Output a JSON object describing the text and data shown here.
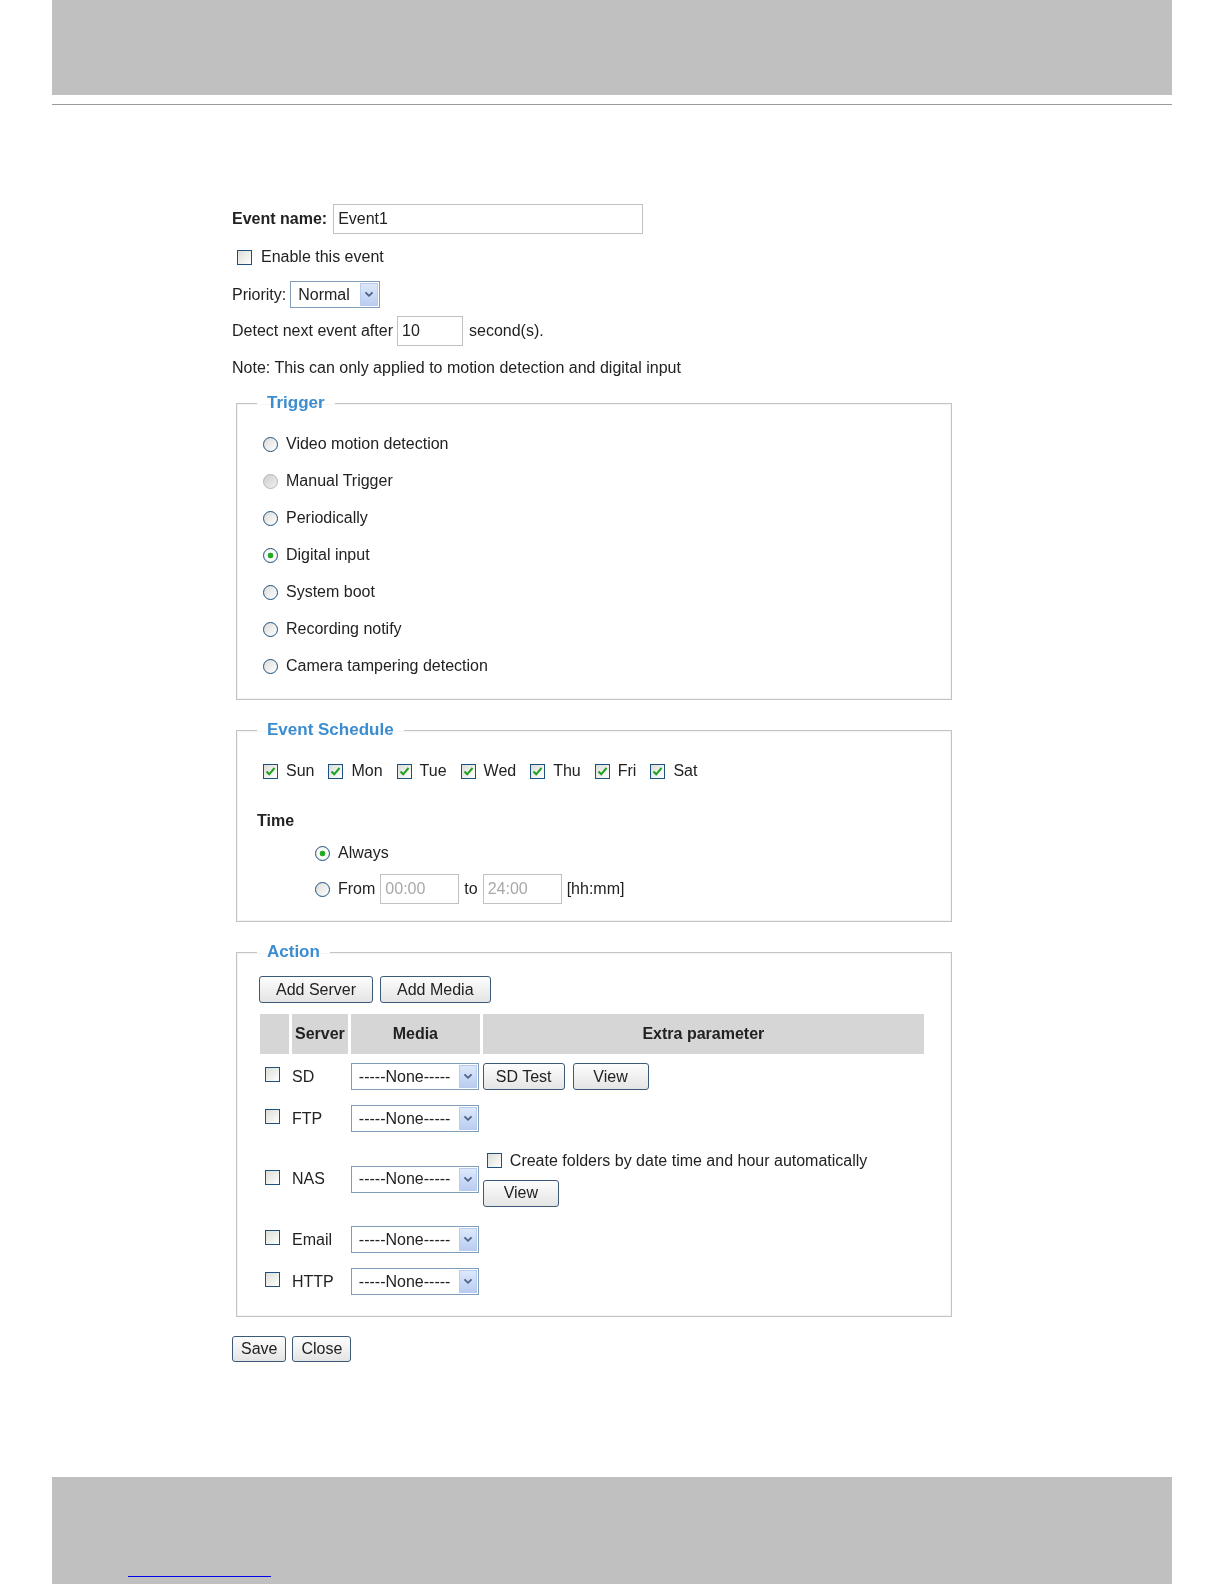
{
  "event_name": {
    "label": "Event name:",
    "value": "Event1"
  },
  "enable": {
    "label": "Enable this event",
    "checked": false
  },
  "priority": {
    "label": "Priority:",
    "value": "Normal"
  },
  "detect": {
    "label": "Detect next event after",
    "value": "10",
    "unit": "second(s)."
  },
  "note": "Note: This can only applied to motion detection and digital input",
  "trigger": {
    "title": "Trigger",
    "options": [
      {
        "label": "Video motion detection",
        "selected": false,
        "disabled": false
      },
      {
        "label": "Manual Trigger",
        "selected": false,
        "disabled": true
      },
      {
        "label": "Periodically",
        "selected": false,
        "disabled": false
      },
      {
        "label": "Digital input",
        "selected": true,
        "disabled": false
      },
      {
        "label": "System boot",
        "selected": false,
        "disabled": false
      },
      {
        "label": "Recording notify",
        "selected": false,
        "disabled": false
      },
      {
        "label": "Camera tampering detection",
        "selected": false,
        "disabled": false
      }
    ]
  },
  "schedule": {
    "title": "Event Schedule",
    "days": [
      {
        "label": "Sun",
        "checked": true
      },
      {
        "label": "Mon",
        "checked": true
      },
      {
        "label": "Tue",
        "checked": true
      },
      {
        "label": "Wed",
        "checked": true
      },
      {
        "label": "Thu",
        "checked": true
      },
      {
        "label": "Fri",
        "checked": true
      },
      {
        "label": "Sat",
        "checked": true
      }
    ],
    "time_label": "Time",
    "always": {
      "label": "Always",
      "selected": true
    },
    "range": {
      "label": "From",
      "selected": false
    },
    "from": {
      "value": "00:00",
      "disabled": true
    },
    "to_label": "to",
    "to": {
      "value": "24:00",
      "disabled": true
    },
    "format": "[hh:mm]"
  },
  "action": {
    "title": "Action",
    "buttons": [
      "Add Server",
      "Add Media"
    ],
    "columns": [
      "Server",
      "Media",
      "Extra parameter"
    ],
    "rows": [
      {
        "server": "SD",
        "checked": false,
        "media": "-----None-----",
        "extras": [
          {
            "kind": "button",
            "label": "SD Test"
          },
          {
            "kind": "button",
            "label": "View"
          }
        ]
      },
      {
        "server": "FTP",
        "checked": false,
        "media": "-----None-----"
      },
      {
        "server": "NAS",
        "checked": false,
        "media": "-----None-----",
        "extras": [
          {
            "kind": "checkbox",
            "label": "Create folders by date time and hour automatically",
            "checked": false
          },
          {
            "kind": "button",
            "label": "View"
          }
        ]
      },
      {
        "server": "Email",
        "checked": false,
        "media": "-----None-----"
      },
      {
        "server": "HTTP",
        "checked": false,
        "media": "-----None-----"
      }
    ]
  },
  "buttons": [
    "Save",
    "Close"
  ]
}
